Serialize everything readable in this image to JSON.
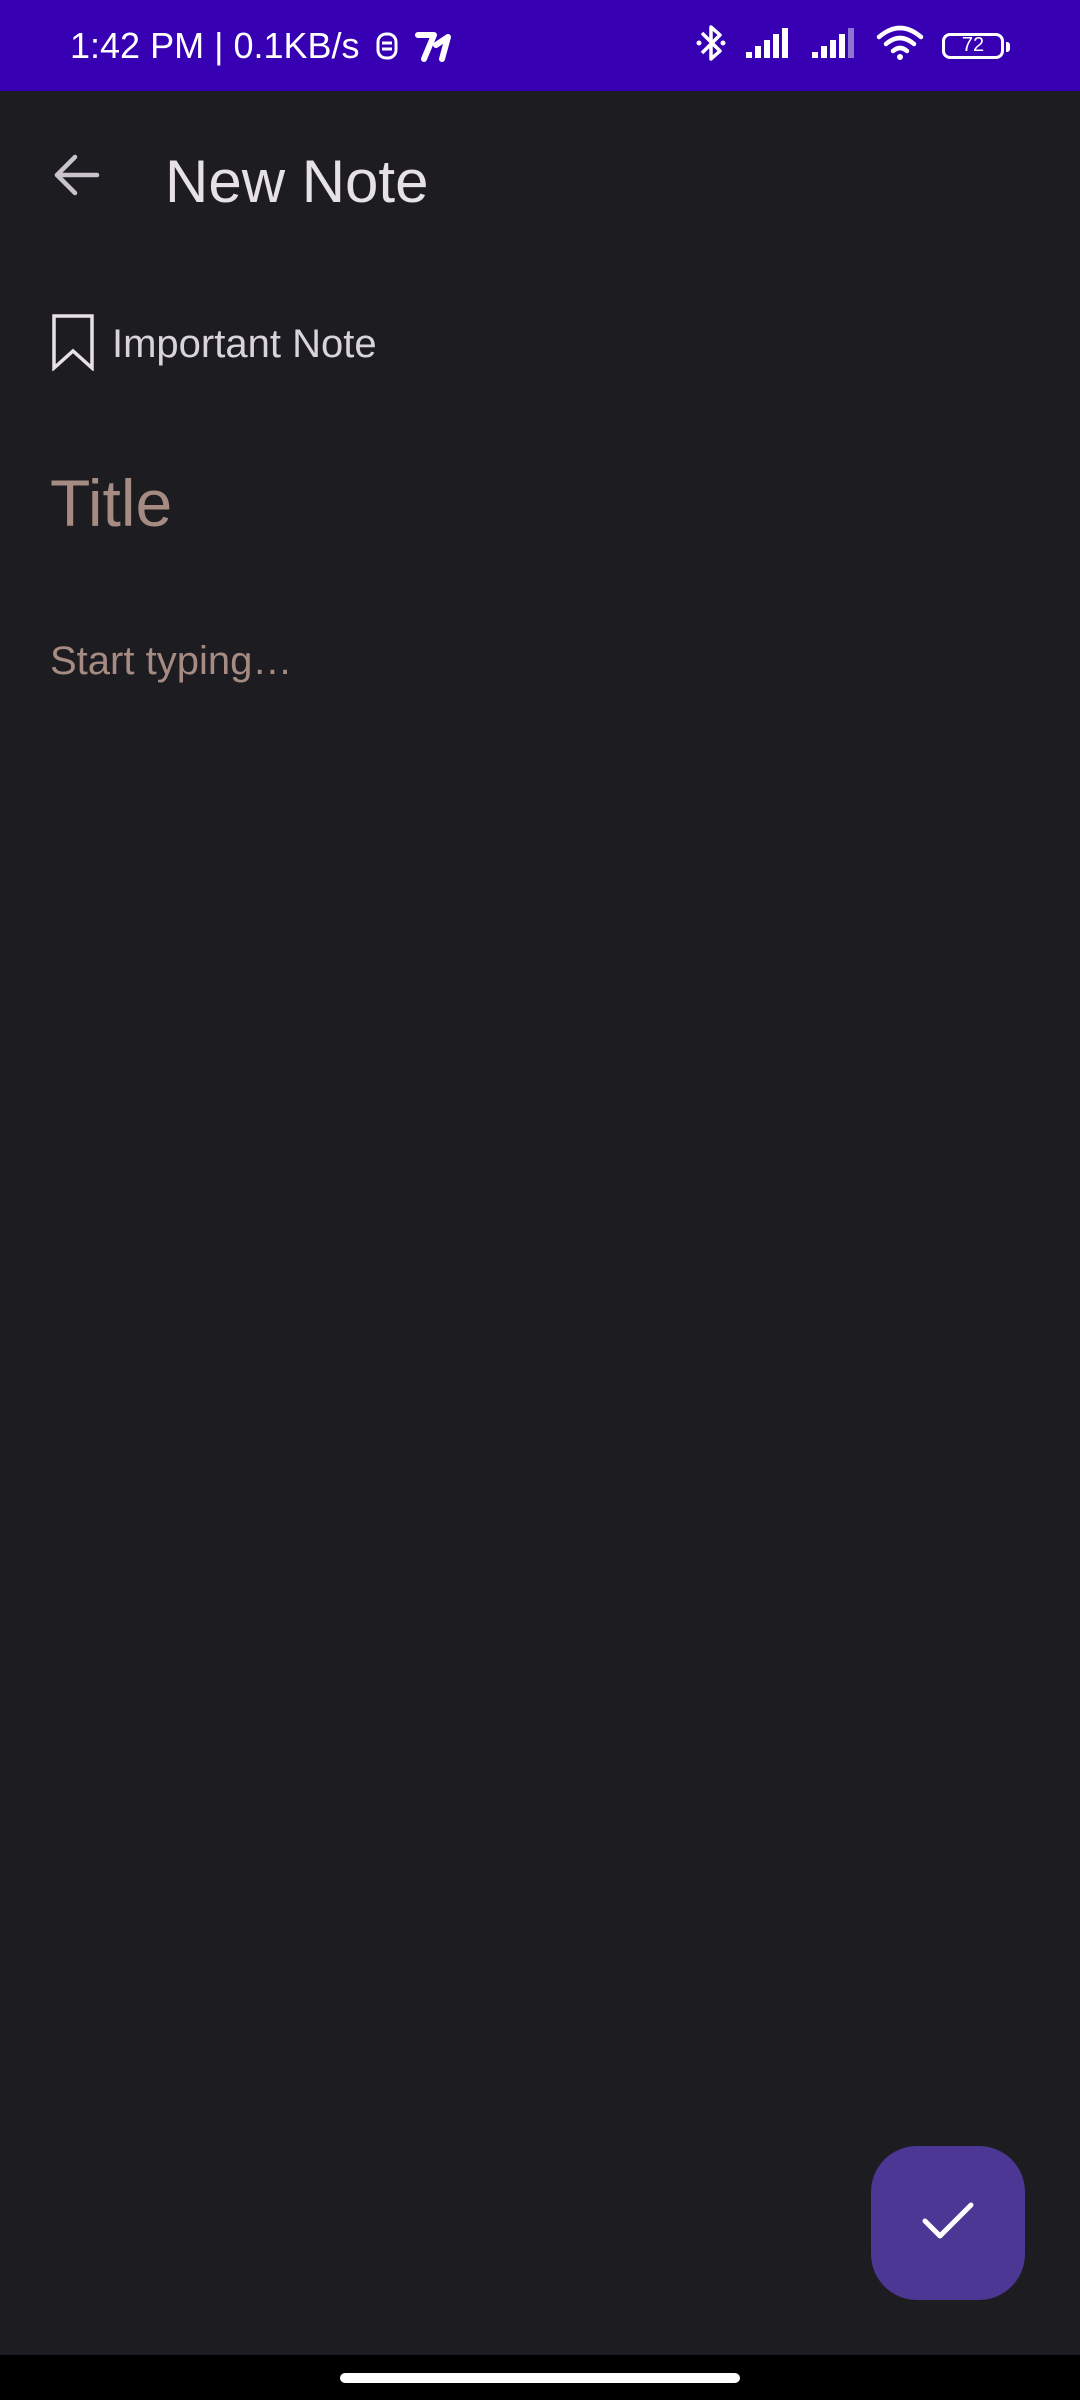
{
  "status_bar": {
    "time": "1:42 PM",
    "separator": "|",
    "network_speed": "0.1KB/s",
    "battery_level": "72",
    "icons": [
      "notification-app-icon",
      "notification-app-icon-2",
      "bluetooth-icon",
      "signal-icon",
      "signal-icon-2",
      "wifi-icon",
      "battery-icon"
    ]
  },
  "app_bar": {
    "title": "New Note",
    "back_icon": "arrow-left-icon"
  },
  "editor": {
    "important_label": "Important Note",
    "important_icon": "bookmark-outline-icon",
    "title_placeholder": "Title",
    "body_placeholder": "Start typing…"
  },
  "fab": {
    "icon": "check-icon"
  },
  "colors": {
    "status_bar": "#3700b3",
    "background": "#1d1c21",
    "fab": "#4c3794",
    "placeholder": "#a68b82",
    "text": "#e6e1e5"
  }
}
